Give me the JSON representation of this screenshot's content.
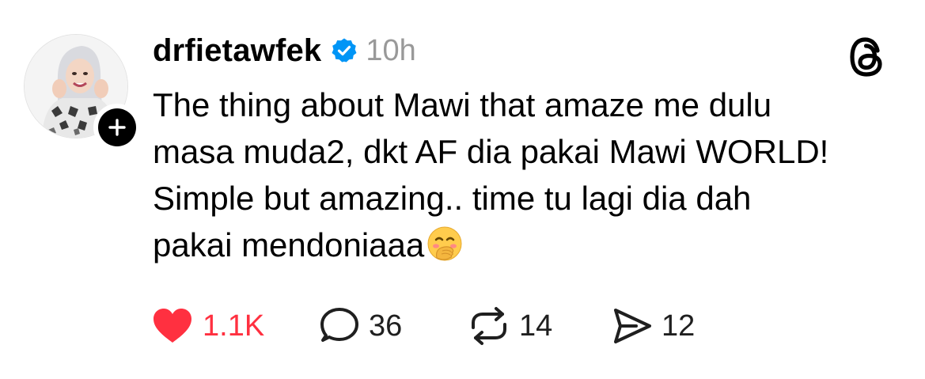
{
  "post": {
    "username": "drfietawfek",
    "time_ago": "10h",
    "verified_icon": "verified-badge-icon",
    "text_lines": [
      "The thing about Mawi that amaze me dulu",
      "masa muda2, dkt AF dia pakai Mawi WORLD!",
      "Simple but amazing.. time tu lagi dia dah",
      "pakai mendoniaaa"
    ],
    "emoji": "face-with-hand-over-mouth"
  },
  "actions": {
    "likes": "1.1K",
    "replies": "36",
    "reposts": "14",
    "shares": "12"
  },
  "colors": {
    "like": "#ff3040",
    "verified": "#0095f6",
    "time": "#999999",
    "text": "#000000"
  },
  "icons": {
    "like": "heart-icon",
    "reply": "comment-bubble-icon",
    "repost": "repost-icon",
    "share": "share-send-icon",
    "app": "threads-logo-icon",
    "follow": "plus-icon"
  }
}
